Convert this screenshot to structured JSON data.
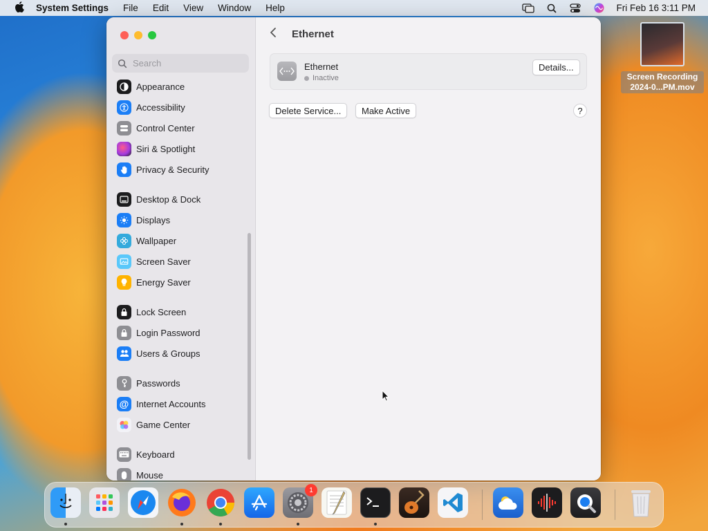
{
  "menubar": {
    "app_name": "System Settings",
    "items": [
      "File",
      "Edit",
      "View",
      "Window",
      "Help"
    ],
    "clock": "Fri Feb 16  3:11 PM"
  },
  "window": {
    "search_placeholder": "Search",
    "sidebar": [
      {
        "label": "Appearance",
        "icon": "appearance-icon",
        "color": "#1c1c1e"
      },
      {
        "label": "Accessibility",
        "icon": "accessibility-icon",
        "color": "#1b7ef6"
      },
      {
        "label": "Control Center",
        "icon": "control-center-icon",
        "color": "#8e8e93"
      },
      {
        "label": "Siri & Spotlight",
        "icon": "siri-icon",
        "color": "#b84ce0"
      },
      {
        "label": "Privacy & Security",
        "icon": "hand-icon",
        "color": "#1b7ef6"
      },
      {
        "label": "Desktop & Dock",
        "icon": "dock-icon",
        "color": "#1c1c1e"
      },
      {
        "label": "Displays",
        "icon": "sun-icon",
        "color": "#1b7ef6"
      },
      {
        "label": "Wallpaper",
        "icon": "wallpaper-icon",
        "color": "#34aadc"
      },
      {
        "label": "Screen Saver",
        "icon": "screen-saver-icon",
        "color": "#5ac8fa"
      },
      {
        "label": "Energy Saver",
        "icon": "bulb-icon",
        "color": "#ffb300"
      },
      {
        "label": "Lock Screen",
        "icon": "lock-screen-icon",
        "color": "#1c1c1e"
      },
      {
        "label": "Login Password",
        "icon": "lock-icon",
        "color": "#8e8e93"
      },
      {
        "label": "Users & Groups",
        "icon": "users-icon",
        "color": "#1b7ef6"
      },
      {
        "label": "Passwords",
        "icon": "key-icon",
        "color": "#8e8e93"
      },
      {
        "label": "Internet Accounts",
        "icon": "at-icon",
        "color": "#1b7ef6"
      },
      {
        "label": "Game Center",
        "icon": "game-center-icon",
        "color": "#f2f2f7"
      },
      {
        "label": "Keyboard",
        "icon": "keyboard-icon",
        "color": "#8e8e93"
      },
      {
        "label": "Mouse",
        "icon": "mouse-icon",
        "color": "#8e8e93"
      }
    ],
    "page_title": "Ethernet",
    "service": {
      "name": "Ethernet",
      "status": "Inactive",
      "details_label": "Details..."
    },
    "delete_label": "Delete Service...",
    "make_active_label": "Make Active",
    "help_label": "?"
  },
  "desktop_file": {
    "line1": "Screen Recording",
    "line2": "2024-0...PM.mov"
  },
  "dock": {
    "apps": [
      {
        "name": "finder",
        "color": "#2a8cf0",
        "running": true
      },
      {
        "name": "launchpad",
        "color": "#e8e8ec",
        "running": false
      },
      {
        "name": "safari",
        "color": "#1a88f0",
        "running": false
      },
      {
        "name": "firefox",
        "color": "#ff7a1a",
        "running": true
      },
      {
        "name": "chrome",
        "color": "#f2f2f2",
        "running": true
      },
      {
        "name": "app-store",
        "color": "#1b8cf6",
        "running": false
      },
      {
        "name": "system-settings",
        "color": "#8a8a8e",
        "running": true,
        "badge": "1"
      },
      {
        "name": "textedit",
        "color": "#f7f7f2",
        "running": false
      },
      {
        "name": "terminal",
        "color": "#1c1c1e",
        "running": true
      },
      {
        "name": "garageband",
        "color": "#d86a2a",
        "running": false
      },
      {
        "name": "vscode",
        "color": "#f5f5f7",
        "running": false
      },
      {
        "name": "weather",
        "color": "#2f7fe0",
        "running": false
      },
      {
        "name": "voice-memos",
        "color": "#1c1c1e",
        "running": false
      },
      {
        "name": "quicktime",
        "color": "#2a2a2e",
        "running": false
      },
      {
        "name": "trash",
        "color": "#dcdcdc",
        "running": false
      }
    ]
  }
}
